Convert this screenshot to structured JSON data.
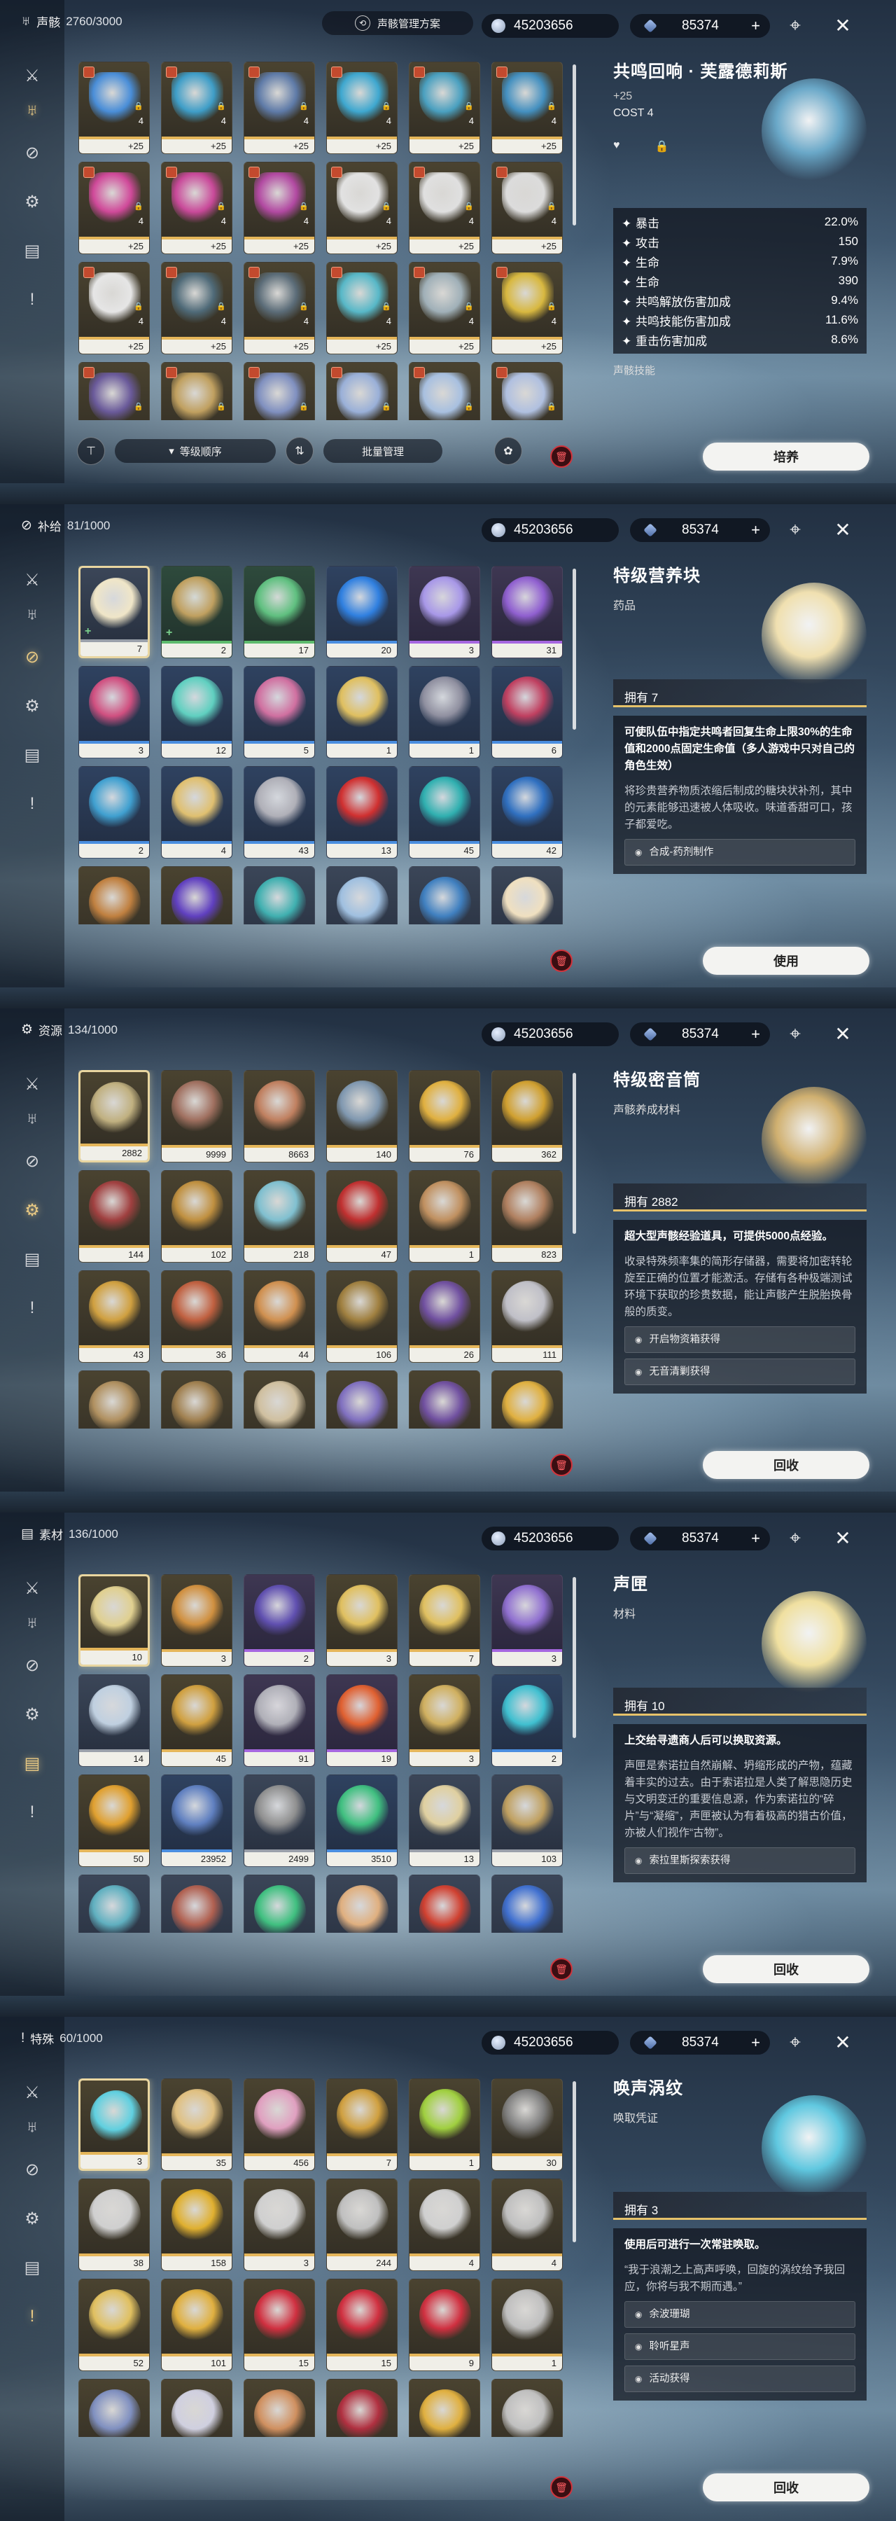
{
  "sidebar": {
    "icons": [
      "crossed-swords-icon",
      "echo-mask-icon",
      "pill-icon",
      "gear-box-icon",
      "chest-icon",
      "exclamation-card-icon"
    ]
  },
  "currency": {
    "astrite": "45203656",
    "lunite": "85374",
    "plus": "+"
  },
  "screens": [
    {
      "category": {
        "label": "声骸",
        "count": "2760/3000",
        "icon": "echo-mask-icon"
      },
      "plan_button": "声骸管理方案",
      "grid_type": "echo",
      "active_side": 1,
      "items": [
        {
          "q": "gold",
          "lv": "4",
          "n": "+25",
          "c": "#4a8ed8"
        },
        {
          "q": "gold",
          "lv": "4",
          "n": "+25",
          "c": "#3f9ec8"
        },
        {
          "q": "gold",
          "lv": "4",
          "n": "+25",
          "c": "#5f7ba8"
        },
        {
          "q": "gold",
          "lv": "4",
          "n": "+25",
          "c": "#3fa8d0"
        },
        {
          "q": "gold",
          "lv": "4",
          "n": "+25",
          "c": "#4aa0c0"
        },
        {
          "q": "gold",
          "lv": "4",
          "n": "+25",
          "c": "#4490c0"
        },
        {
          "q": "gold",
          "lv": "4",
          "n": "+25",
          "c": "#d04a9a"
        },
        {
          "q": "gold",
          "lv": "4",
          "n": "+25",
          "c": "#c94a9a"
        },
        {
          "q": "gold",
          "lv": "4",
          "n": "+25",
          "c": "#b24aa2"
        },
        {
          "q": "gold",
          "lv": "4",
          "n": "+25",
          "c": "#e2e2e2"
        },
        {
          "q": "gold",
          "lv": "4",
          "n": "+25",
          "c": "#e0e0e0"
        },
        {
          "q": "gold",
          "lv": "4",
          "n": "+25",
          "c": "#dcdcdc"
        },
        {
          "q": "gold",
          "lv": "4",
          "n": "+25",
          "c": "#e6e6e6"
        },
        {
          "q": "gold",
          "lv": "4",
          "n": "+25",
          "c": "#4f6a78"
        },
        {
          "q": "gold",
          "lv": "4",
          "n": "+25",
          "c": "#5b6c78"
        },
        {
          "q": "gold",
          "lv": "4",
          "n": "+25",
          "c": "#58b8c8"
        },
        {
          "q": "gold",
          "lv": "4",
          "n": "+25",
          "c": "#a0b0b8"
        },
        {
          "q": "gold",
          "lv": "4",
          "n": "+25",
          "c": "#d8b840"
        },
        {
          "q": "gold",
          "lv": "",
          "n": "",
          "c": "#6a5a9a"
        },
        {
          "q": "gold",
          "lv": "",
          "n": "",
          "c": "#c0a060"
        },
        {
          "q": "gold",
          "lv": "",
          "n": "",
          "c": "#8090c0"
        },
        {
          "q": "gold",
          "lv": "",
          "n": "",
          "c": "#9ab0d8"
        },
        {
          "q": "gold",
          "lv": "",
          "n": "",
          "c": "#a8c0e0"
        },
        {
          "q": "gold",
          "lv": "",
          "n": "",
          "c": "#b0c0e0"
        }
      ],
      "detail": {
        "title": "共鸣回响 · 芙露德莉斯",
        "level": "+25",
        "cost": "COST  4",
        "art_color": "#6aa8c8",
        "stats": [
          {
            "label": "暴击",
            "value": "22.0%"
          },
          {
            "label": "攻击",
            "value": "150"
          },
          {
            "label": "生命",
            "value": "7.9%"
          },
          {
            "label": "生命",
            "value": "390"
          },
          {
            "label": "共鸣解放伤害加成",
            "value": "9.4%"
          },
          {
            "label": "共鸣技能伤害加成",
            "value": "11.6%"
          },
          {
            "label": "重击伤害加成",
            "value": "8.6%"
          }
        ],
        "skill_label": "声骸技能",
        "action": "培养"
      },
      "bottom": {
        "sort_label": "等级顺序",
        "batch_label": "批量管理"
      }
    },
    {
      "category": {
        "label": "补给",
        "count": "81/1000",
        "icon": "pill-icon"
      },
      "grid_type": "item",
      "active_side": 2,
      "items": [
        {
          "q": "gray",
          "n": "7",
          "m": "+",
          "c": "#f0e6c8",
          "sel": true
        },
        {
          "q": "green",
          "n": "2",
          "m": "+",
          "c": "#c0a060"
        },
        {
          "q": "green",
          "n": "17",
          "m": "",
          "c": "#60c080"
        },
        {
          "q": "blue",
          "n": "20",
          "m": "",
          "c": "#3080e0"
        },
        {
          "q": "purple",
          "n": "3",
          "m": "",
          "c": "#a898e8"
        },
        {
          "q": "purple",
          "n": "31",
          "m": "",
          "c": "#9060d0"
        },
        {
          "q": "blue",
          "n": "3",
          "m": "",
          "c": "#d05080"
        },
        {
          "q": "blue",
          "n": "12",
          "m": "",
          "c": "#60d0c0"
        },
        {
          "q": "blue",
          "n": "5",
          "m": "",
          "c": "#d070a0"
        },
        {
          "q": "blue",
          "n": "1",
          "m": "",
          "c": "#e0c060"
        },
        {
          "q": "blue",
          "n": "1",
          "m": "",
          "c": "#9090a0"
        },
        {
          "q": "blue",
          "n": "6",
          "m": "",
          "c": "#c04060"
        },
        {
          "q": "blue",
          "n": "2",
          "m": "",
          "c": "#40a0d0"
        },
        {
          "q": "blue",
          "n": "4",
          "m": "",
          "c": "#e0c070"
        },
        {
          "q": "blue",
          "n": "43",
          "m": "",
          "c": "#b0b0b8"
        },
        {
          "q": "blue",
          "n": "13",
          "m": "",
          "c": "#d03030"
        },
        {
          "q": "blue",
          "n": "45",
          "m": "",
          "c": "#30b0b0"
        },
        {
          "q": "blue",
          "n": "42",
          "m": "",
          "c": "#3070c0"
        },
        {
          "q": "gold",
          "n": "",
          "m": "",
          "c": "#c08040"
        },
        {
          "q": "gold",
          "n": "",
          "m": "",
          "c": "#6040c0"
        },
        {
          "q": "gray",
          "n": "",
          "m": "",
          "c": "#40b0b0"
        },
        {
          "q": "gray",
          "n": "",
          "m": "",
          "c": "#a0c0e0"
        },
        {
          "q": "gray",
          "n": "",
          "m": "",
          "c": "#4080c0"
        },
        {
          "q": "gray",
          "n": "",
          "m": "",
          "c": "#f0e0c0"
        }
      ],
      "detail": {
        "title": "特级营养块",
        "subtitle": "药品",
        "owned": "拥有 7",
        "art_color": "#f0e0b0",
        "effect": "可使队伍中指定共鸣者回复生命上限30%的生命值和2000点固定生命值（多人游戏中只对自己的角色生效）",
        "lore": "将珍贵营养物质浓缩后制成的糖块状补剂，其中的元素能够迅速被人体吸收。味道香甜可口，孩子都爱吃。",
        "sources": [
          "合成-药剂制作"
        ],
        "action": "使用"
      }
    },
    {
      "category": {
        "label": "资源",
        "count": "134/1000",
        "icon": "gear-box-icon"
      },
      "grid_type": "item",
      "active_side": 3,
      "items": [
        {
          "q": "gold",
          "n": "2882",
          "c": "#c0b080",
          "sel": true
        },
        {
          "q": "gold",
          "n": "9999",
          "c": "#a07060"
        },
        {
          "q": "gold",
          "n": "8663",
          "c": "#c08060"
        },
        {
          "q": "gold",
          "n": "140",
          "c": "#8098b0"
        },
        {
          "q": "gold",
          "n": "76",
          "c": "#e0b040"
        },
        {
          "q": "gold",
          "n": "362",
          "c": "#d0a030"
        },
        {
          "q": "gold",
          "n": "144",
          "c": "#a04040"
        },
        {
          "q": "gold",
          "n": "102",
          "c": "#c09040"
        },
        {
          "q": "gold",
          "n": "218",
          "c": "#80c0d0"
        },
        {
          "q": "gold",
          "n": "47",
          "c": "#c03030"
        },
        {
          "q": "gold",
          "n": "1",
          "c": "#c09060"
        },
        {
          "q": "gold",
          "n": "823",
          "c": "#b08060"
        },
        {
          "q": "gold",
          "n": "43",
          "c": "#d0a040"
        },
        {
          "q": "gold",
          "n": "36",
          "c": "#c06040"
        },
        {
          "q": "gold",
          "n": "44",
          "c": "#d09050"
        },
        {
          "q": "gold",
          "n": "106",
          "c": "#a08040"
        },
        {
          "q": "gold",
          "n": "26",
          "c": "#7050a0"
        },
        {
          "q": "gold",
          "n": "111",
          "c": "#c0c0c8"
        },
        {
          "q": "gold",
          "n": "",
          "c": "#b09060"
        },
        {
          "q": "gold",
          "n": "",
          "c": "#a08050"
        },
        {
          "q": "gold",
          "n": "",
          "c": "#d0c0a0"
        },
        {
          "q": "gold",
          "n": "",
          "c": "#8070c0"
        },
        {
          "q": "gold",
          "n": "",
          "c": "#7050a0"
        },
        {
          "q": "gold",
          "n": "",
          "c": "#e0b040"
        }
      ],
      "detail": {
        "title": "特级密音筒",
        "subtitle": "声骸养成材料",
        "owned": "拥有 2882",
        "art_color": "#d0b070",
        "effect": "超大型声骸经验道具，可提供5000点经验。",
        "lore": "收录特殊频率集的简形存储器，需要将加密转轮旋至正确的位置才能激活。存储有各种极端测试环境下获取的珍贵数据，能让声骸产生脱胎换骨般的质变。",
        "sources": [
          "开启物资箱获得",
          "无音清剿获得"
        ],
        "action": "回收"
      }
    },
    {
      "category": {
        "label": "素材",
        "count": "136/1000",
        "icon": "chest-icon"
      },
      "grid_type": "item",
      "active_side": 4,
      "items": [
        {
          "q": "gold",
          "n": "10",
          "c": "#e0d090",
          "sel": true
        },
        {
          "q": "gold",
          "n": "3",
          "c": "#d09040"
        },
        {
          "q": "purple",
          "n": "2",
          "c": "#6050b0"
        },
        {
          "q": "gold",
          "n": "3",
          "c": "#e0c060"
        },
        {
          "q": "gold",
          "n": "7",
          "c": "#e0c060"
        },
        {
          "q": "purple",
          "n": "3",
          "c": "#9070d0"
        },
        {
          "q": "gray",
          "n": "14",
          "c": "#c0d0e0"
        },
        {
          "q": "gold",
          "n": "45",
          "c": "#d0a040"
        },
        {
          "q": "purple",
          "n": "91",
          "c": "#b0b0b8"
        },
        {
          "q": "purple",
          "n": "19",
          "c": "#e06030"
        },
        {
          "q": "gold",
          "n": "3",
          "c": "#d0b060"
        },
        {
          "q": "blue",
          "n": "2",
          "c": "#40c0d0"
        },
        {
          "q": "gold",
          "n": "50",
          "c": "#e0a030"
        },
        {
          "q": "blue",
          "n": "23952",
          "c": "#6080c0"
        },
        {
          "q": "gray",
          "n": "2499",
          "c": "#909090"
        },
        {
          "q": "blue",
          "n": "3510",
          "c": "#40c080"
        },
        {
          "q": "gray",
          "n": "13",
          "c": "#e0d0a0"
        },
        {
          "q": "gray",
          "n": "103",
          "c": "#c0a060"
        },
        {
          "q": "gray",
          "n": "",
          "c": "#60b0c0"
        },
        {
          "q": "gray",
          "n": "",
          "c": "#b06050"
        },
        {
          "q": "gray",
          "n": "",
          "c": "#40c080"
        },
        {
          "q": "gray",
          "n": "",
          "c": "#e0b080"
        },
        {
          "q": "gray",
          "n": "",
          "c": "#d04030"
        },
        {
          "q": "gray",
          "n": "",
          "c": "#4070d0"
        }
      ],
      "detail": {
        "title": "声匣",
        "subtitle": "材料",
        "owned": "拥有 10",
        "art_color": "#f0e0a0",
        "effect": "上交给寻遗商人后可以换取资源。",
        "lore": "声匣是索诺拉自然崩解、坍缩形成的产物，蕴藏着丰实的过去。由于索诺拉是人类了解思隐历史与文明变迁的重要信息源，作为索诺拉的“碎片”与“凝缩”，声匣被认为有着极高的猎古价值，亦被人们视作“古物”。",
        "sources": [
          "索拉里斯探索获得"
        ],
        "action": "回收"
      }
    },
    {
      "category": {
        "label": "特殊",
        "count": "60/1000",
        "icon": "exclamation-card-icon"
      },
      "grid_type": "item",
      "active_side": 5,
      "items": [
        {
          "q": "gold",
          "n": "3",
          "c": "#60d0e0",
          "sel": true
        },
        {
          "q": "gold",
          "n": "35",
          "c": "#e0c080"
        },
        {
          "q": "gold",
          "n": "456",
          "c": "#e0a0c0"
        },
        {
          "q": "gold",
          "n": "7",
          "c": "#d0a040"
        },
        {
          "q": "gold",
          "n": "1",
          "c": "#a0d040"
        },
        {
          "q": "gold",
          "n": "30",
          "c": "#808080"
        },
        {
          "q": "gold",
          "n": "38",
          "c": "#d0d0d0"
        },
        {
          "q": "gold",
          "n": "158",
          "c": "#e0b030"
        },
        {
          "q": "gold",
          "n": "3",
          "c": "#d0d0d0"
        },
        {
          "q": "gold",
          "n": "244",
          "c": "#c0c0c0"
        },
        {
          "q": "gold",
          "n": "4",
          "c": "#d0d0d0"
        },
        {
          "q": "gold",
          "n": "4",
          "c": "#c0c0c0"
        },
        {
          "q": "gold",
          "n": "52",
          "c": "#e0c060"
        },
        {
          "q": "gold",
          "n": "101",
          "c": "#e0b040"
        },
        {
          "q": "gold",
          "n": "15",
          "c": "#d03040"
        },
        {
          "q": "gold",
          "n": "15",
          "c": "#d03040"
        },
        {
          "q": "gold",
          "n": "9",
          "c": "#d03040"
        },
        {
          "q": "gold",
          "n": "1",
          "c": "#c0c0c0"
        },
        {
          "q": "gold",
          "n": "",
          "c": "#8090c0"
        },
        {
          "q": "gold",
          "n": "",
          "c": "#d0d0e0"
        },
        {
          "q": "gold",
          "n": "",
          "c": "#d09060"
        },
        {
          "q": "gold",
          "n": "",
          "c": "#b03040"
        },
        {
          "q": "gold",
          "n": "",
          "c": "#e0b040"
        },
        {
          "q": "gold",
          "n": "",
          "c": "#c0c0c0"
        }
      ],
      "detail": {
        "title": "唤声涡纹",
        "subtitle": "唤取凭证",
        "owned": "拥有 3",
        "art_color": "#60c8e0",
        "effect": "使用后可进行一次常驻唤取。",
        "lore": "“我于浪潮之上高声呼唤，回旋的涡纹给予我回应，你将与我不期而遇。”",
        "sources": [
          "余波珊瑚",
          "聆听星声",
          "活动获得"
        ],
        "action": "回收"
      }
    }
  ]
}
